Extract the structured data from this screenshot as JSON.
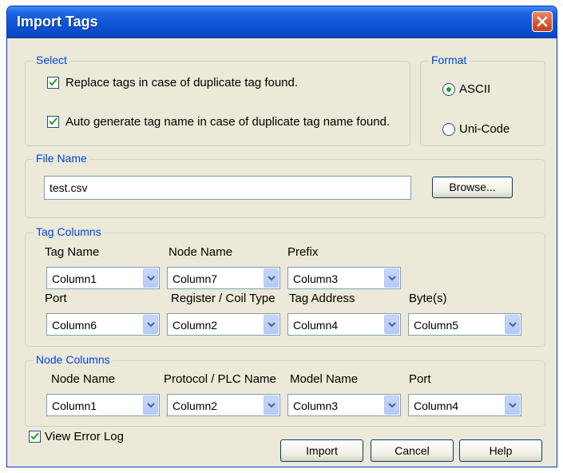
{
  "dialog": {
    "title": "Import Tags"
  },
  "select": {
    "title": "Select",
    "replace_tags": {
      "label": "Replace tags in case of duplicate tag found.",
      "checked": true
    },
    "auto_generate": {
      "label": "Auto generate tag name in case of duplicate tag name found.",
      "checked": true
    }
  },
  "format": {
    "title": "Format",
    "options": [
      {
        "label": "ASCII",
        "selected": true
      },
      {
        "label": "Uni-Code",
        "selected": false
      }
    ]
  },
  "file": {
    "title": "File Name",
    "value": "test.csv",
    "browse_label": "Browse..."
  },
  "tag_columns": {
    "title": "Tag Columns",
    "fields": [
      {
        "label": "Tag Name",
        "value": "Column1"
      },
      {
        "label": "Node Name",
        "value": "Column7"
      },
      {
        "label": "Prefix",
        "value": "Column3"
      },
      {
        "label": "Port",
        "value": "Column6"
      },
      {
        "label": "Register / Coil Type",
        "value": "Column2"
      },
      {
        "label": "Tag Address",
        "value": "Column4"
      },
      {
        "label": "Byte(s)",
        "value": "Column5"
      }
    ]
  },
  "node_columns": {
    "title": "Node Columns",
    "fields": [
      {
        "label": "Node Name",
        "value": "Column1"
      },
      {
        "label": "Protocol / PLC Name",
        "value": "Column2"
      },
      {
        "label": "Model Name",
        "value": "Column3"
      },
      {
        "label": "Port",
        "value": "Column4"
      }
    ]
  },
  "view_error_log": {
    "label": "View Error Log",
    "checked": true
  },
  "buttons": {
    "import": "Import",
    "cancel": "Cancel",
    "help": "Help"
  },
  "colors": {
    "group_title": "#0046d5",
    "titlebar": "#0b55d6",
    "dialog_bg": "#ece9d8"
  }
}
